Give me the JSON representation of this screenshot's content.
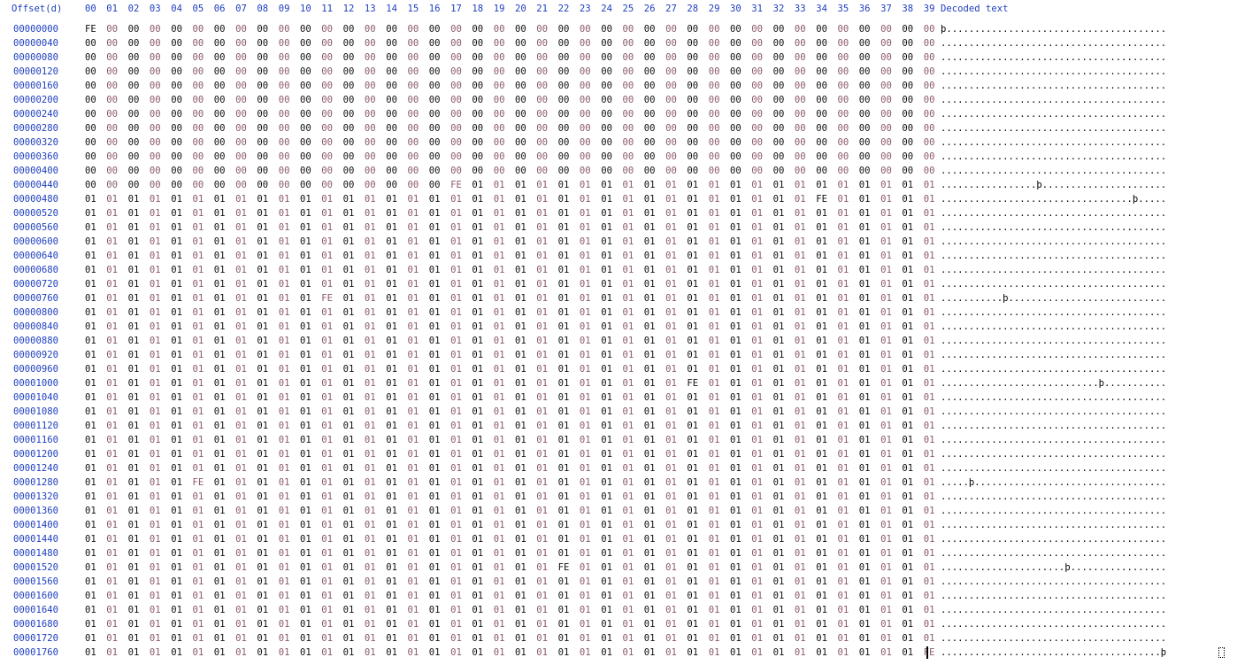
{
  "header": {
    "offset_label": "Offset(d)",
    "columns": [
      "00",
      "01",
      "02",
      "03",
      "04",
      "05",
      "06",
      "07",
      "08",
      "09",
      "10",
      "11",
      "12",
      "13",
      "14",
      "15",
      "16",
      "17",
      "18",
      "19",
      "20",
      "21",
      "22",
      "23",
      "24",
      "25",
      "26",
      "27",
      "28",
      "29",
      "30",
      "31",
      "32",
      "33",
      "34",
      "35",
      "36",
      "37",
      "38",
      "39"
    ],
    "decoded_label": "Decoded text"
  },
  "offsets": [
    "00000000",
    "00000040",
    "00000080",
    "00000120",
    "00000160",
    "00000200",
    "00000240",
    "00000280",
    "00000320",
    "00000360",
    "00000400",
    "00000440",
    "00000480",
    "00000520",
    "00000560",
    "00000600",
    "00000640",
    "00000680",
    "00000720",
    "00000760",
    "00000800",
    "00000840",
    "00000880",
    "00000920",
    "00000960",
    "00001000",
    "00001040",
    "00001080",
    "00001120",
    "00001160",
    "00001200",
    "00001240",
    "00001280",
    "00001320",
    "00001360",
    "00001400",
    "00001440",
    "00001480",
    "00001520",
    "00001560",
    "00001600",
    "00001640",
    "00001680",
    "00001720",
    "00001760"
  ],
  "bytes": {
    "zero": "00",
    "one": "01",
    "marker": "FE",
    "fill_zero_until": 457,
    "marker_positions": [
      0,
      457,
      514,
      771,
      1028,
      1285,
      1542,
      1799
    ]
  },
  "decoded": {
    "nonprint_char": ".",
    "marker_char": "þ"
  },
  "colors": {
    "offset_blue": "#1f3fbf",
    "byte_even": "#111111",
    "byte_odd": "#8a5a66"
  }
}
